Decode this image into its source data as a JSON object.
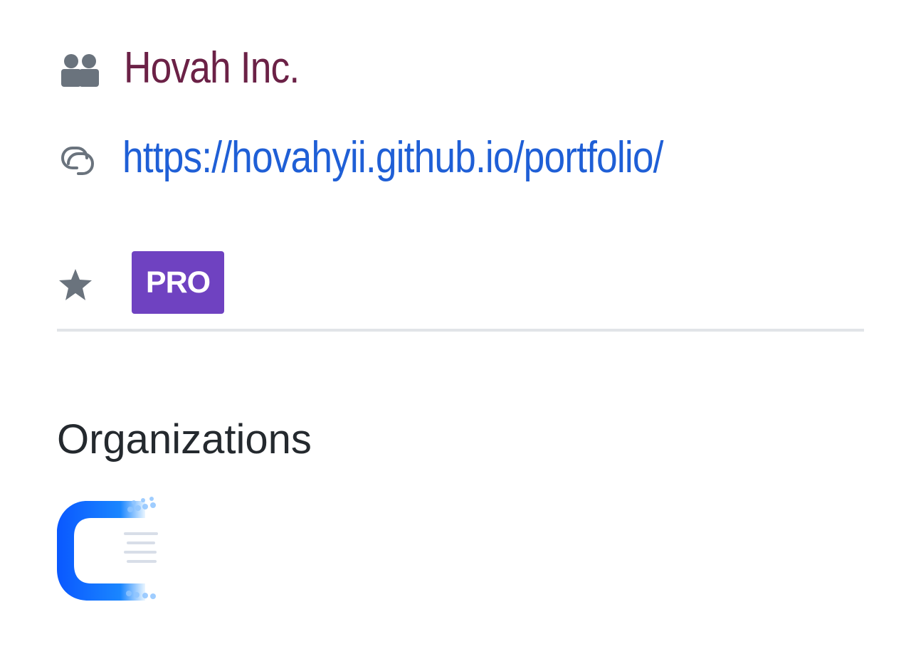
{
  "profile": {
    "company": "Hovah Inc.",
    "company_icon": "people-icon",
    "website": "https://hovahyii.github.io/portfolio/",
    "website_icon": "link-icon",
    "badge_icon": "star-icon",
    "badge": "PRO"
  },
  "organizations": {
    "heading": "Organizations",
    "items": [
      {
        "icon": "organization-logo"
      }
    ]
  },
  "colors": {
    "company_text": "#6b2146",
    "link": "#1f5fd6",
    "icon": "#6a737d",
    "pro_badge": "#6f42c1",
    "divider": "#e1e4e8",
    "org_logo": "#1766ff"
  }
}
